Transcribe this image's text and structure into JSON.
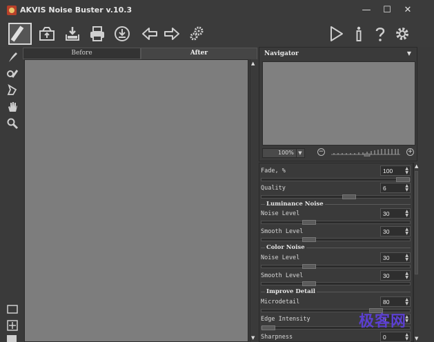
{
  "window": {
    "title": "AKVIS Noise Buster v.10.3",
    "minimize": "—",
    "maximize": "☐",
    "close": "✕"
  },
  "toolbar": {
    "icons": [
      "logo-brush-icon",
      "open-file-icon",
      "save-icon",
      "print-icon",
      "share-icon",
      "undo-arrow-icon",
      "redo-arrow-icon",
      "settings-gears-icon",
      "run-play-icon",
      "info-icon",
      "help-icon",
      "preferences-gear-icon"
    ]
  },
  "tools": {
    "icons": [
      "brush-icon",
      "eraser-icon",
      "history-brush-icon",
      "hand-icon",
      "zoom-icon",
      "frame-icon",
      "fit-icon"
    ]
  },
  "tabs": {
    "before": "Before",
    "after": "After",
    "active": "after"
  },
  "navigator": {
    "title": "Navigator",
    "zoom": "100%",
    "minus": "−",
    "plus": "+"
  },
  "params": {
    "fade": {
      "label": "Fade, %",
      "value": "100",
      "level": 100
    },
    "quality": {
      "label": "Quality",
      "value": "6",
      "level": 60
    },
    "luminance_section": "Luminance Noise",
    "lum_noise": {
      "label": "Noise Level",
      "value": "30",
      "level": 30
    },
    "lum_smooth": {
      "label": "Smooth Level",
      "value": "30",
      "level": 30
    },
    "color_section": "Color Noise",
    "color_noise": {
      "label": "Noise Level",
      "value": "30",
      "level": 30
    },
    "color_smooth": {
      "label": "Smooth Level",
      "value": "30",
      "level": 30
    },
    "detail_section": "Improve Detail",
    "microdetail": {
      "label": "Microdetail",
      "value": "80",
      "level": 80
    },
    "edge": {
      "label": "Edge Intensity",
      "value": "0",
      "level": 0
    },
    "sharpness": {
      "label": "Sharpness",
      "value": "0",
      "level": 0
    }
  },
  "watermark": "极客网",
  "colors": {
    "background": "#3a3a3a",
    "canvas": "#7d7d7d",
    "watermark": "#5b3fd0"
  }
}
